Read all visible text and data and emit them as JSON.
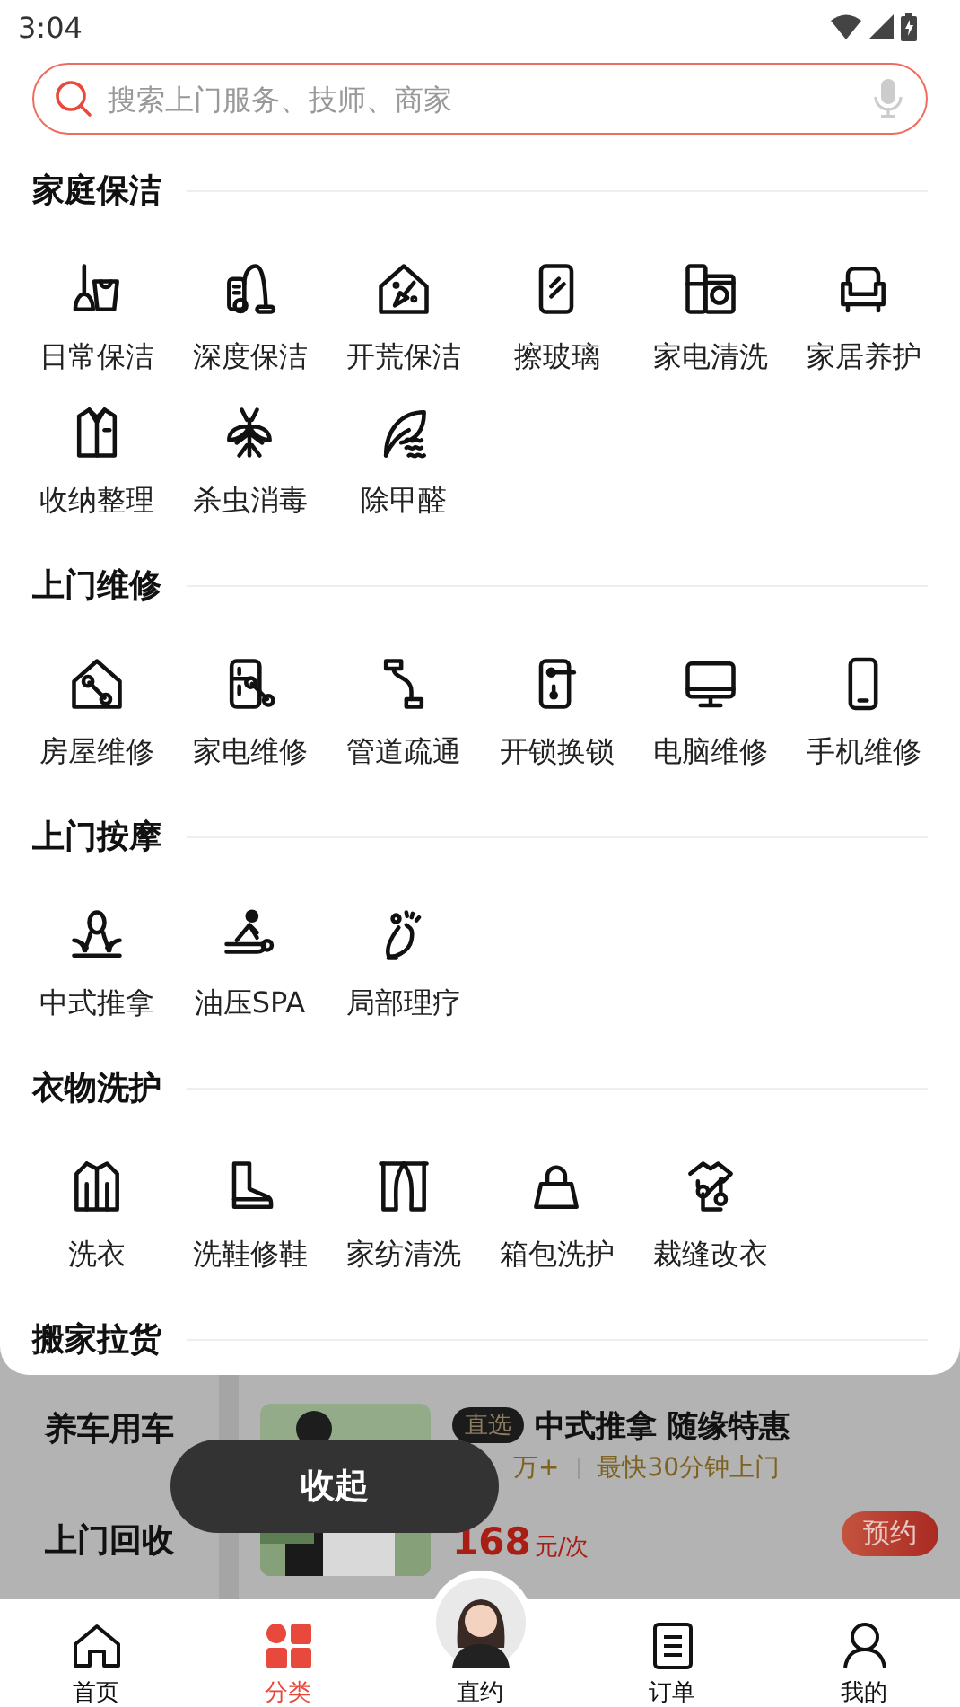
{
  "status_bar": {
    "time": "3:04"
  },
  "search": {
    "placeholder": "搜索上门服务、技师、商家"
  },
  "sections": [
    {
      "title": "家庭保洁",
      "items": [
        "日常保洁",
        "深度保洁",
        "开荒保洁",
        "擦玻璃",
        "家电清洗",
        "家居养护",
        "收纳整理",
        "杀虫消毒",
        "除甲醛"
      ]
    },
    {
      "title": "上门维修",
      "items": [
        "房屋维修",
        "家电维修",
        "管道疏通",
        "开锁换锁",
        "电脑维修",
        "手机维修"
      ]
    },
    {
      "title": "上门按摩",
      "items": [
        "中式推拿",
        "油压SPA",
        "局部理疗"
      ]
    },
    {
      "title": "衣物洗护",
      "items": [
        "洗衣",
        "洗鞋修鞋",
        "家纺清洗",
        "箱包洗护",
        "裁缝改衣"
      ]
    },
    {
      "title": "搬家拉货"
    }
  ],
  "background_page": {
    "sidebar": [
      {
        "label": "养车用车"
      },
      {
        "label": "上门回收"
      }
    ],
    "product": {
      "badge": "直选",
      "title": "中式推拿 随缘特惠",
      "sales": "万+",
      "eta": "最快30分钟上门",
      "price": "168",
      "unit": "元/次",
      "button": "预约"
    }
  },
  "toast": {
    "label": "收起"
  },
  "nav": [
    {
      "label": "首页",
      "selected": false
    },
    {
      "label": "分类",
      "selected": true
    },
    {
      "label": "直约",
      "selected": false,
      "kind": "avatar"
    },
    {
      "label": "订单",
      "selected": false
    },
    {
      "label": "我的",
      "selected": false
    }
  ]
}
